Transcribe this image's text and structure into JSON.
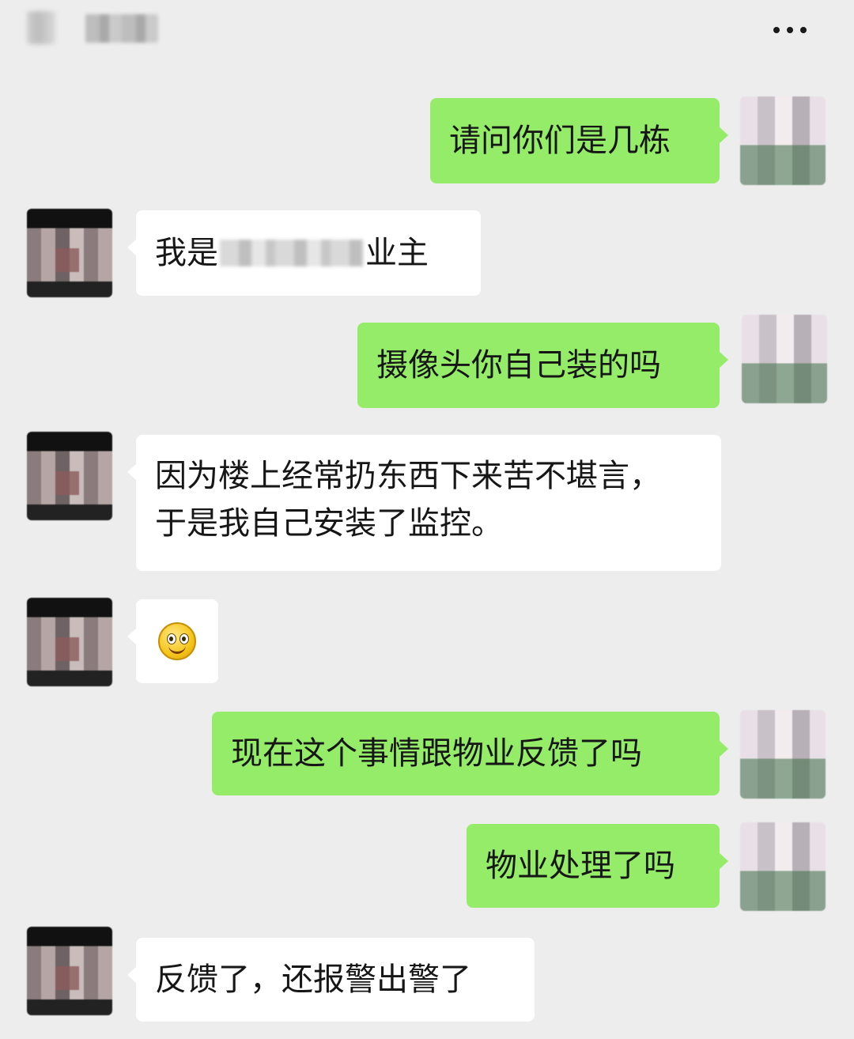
{
  "header": {
    "more_icon": "more-horizontal-icon"
  },
  "colors": {
    "background": "#ededed",
    "sent_bubble": "#95ec69",
    "received_bubble": "#ffffff"
  },
  "messages": [
    {
      "sender": "me",
      "text": "请问你们是几栋"
    },
    {
      "sender": "other",
      "text_prefix": "我是",
      "text_suffix": "业主",
      "redacted": true
    },
    {
      "sender": "me",
      "text": "摄像头你自己装的吗"
    },
    {
      "sender": "other",
      "lines": [
        "因为楼上经常扔东西下来苦不堪言，",
        "于是我自己安装了监控。"
      ]
    },
    {
      "sender": "other",
      "emoji": "smile-emoji"
    },
    {
      "sender": "me",
      "text": "现在这个事情跟物业反馈了吗"
    },
    {
      "sender": "me",
      "text": "物业处理了吗"
    },
    {
      "sender": "other",
      "text": "反馈了，还报警出警了"
    }
  ]
}
